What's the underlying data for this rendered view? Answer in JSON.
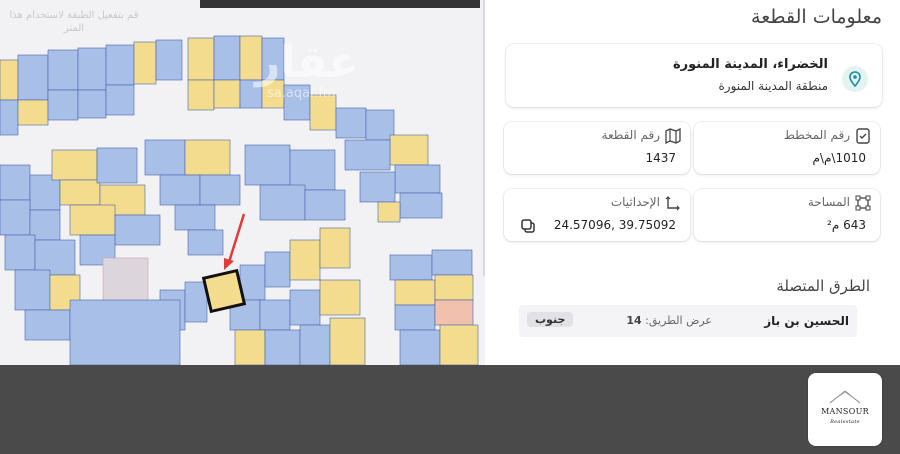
{
  "map": {
    "hint": "قم بتفعيل الطبقة لاستخدام هذا المتر",
    "watermark_main": "عقار",
    "watermark_sub": "sa.aqar.fm",
    "colors": {
      "blue": "#a8bfe8",
      "yellow": "#f4dc8e",
      "pink": "#f1c1ae",
      "gray": "#dcd6dc",
      "highlight": "#f4dc8e",
      "arrow": "#e03b36"
    }
  },
  "panel": {
    "title": "معلومات القطعة",
    "location": {
      "main": "الخضراء، المدينة المنورة",
      "sub": "منطقة المدينة المنورة",
      "icon": "map-pin-icon"
    },
    "plan_number": {
      "label": "رقم المخطط",
      "value": "1010\\م\\م"
    },
    "parcel_number": {
      "label": "رقم القطعة",
      "value": "1437"
    },
    "area": {
      "label": "المساحة",
      "value": "643 م²"
    },
    "coordinates": {
      "label": "الإحداثيات",
      "value": "39.75092 ,24.57096"
    },
    "roads": {
      "title": "الطرق المتصلة",
      "items": [
        {
          "name": "الحسين بن باز",
          "width_label": "عرض الطريق:",
          "width_value": "14",
          "direction": "جنوب"
        }
      ]
    }
  },
  "brand": {
    "logo_text": "MANSOUR",
    "logo_subtext": "Realestate",
    "accent": "#1a8fa0"
  }
}
